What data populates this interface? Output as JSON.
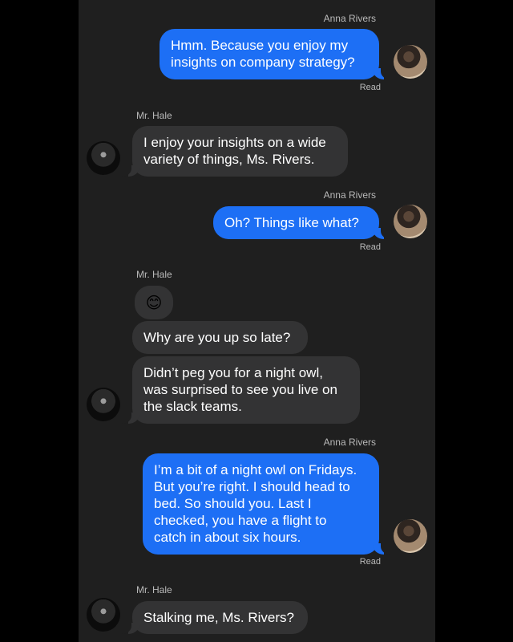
{
  "contacts": {
    "anna": {
      "name": "Anna Rivers",
      "avatar_icon": "anna-rivers-avatar"
    },
    "hale": {
      "name": "Mr. Hale",
      "avatar_icon": "mr-hale-avatar"
    }
  },
  "colors": {
    "background": "#1f1f1f",
    "outgoing_bubble": "#1d6ff5",
    "incoming_bubble": "#333334",
    "label_text": "#b9b9b9"
  },
  "messages": [
    {
      "sender": "Anna Rivers",
      "direction": "outgoing",
      "text": "Hmm. Because you enjoy my\ninsights on company strategy?",
      "status": "Read"
    },
    {
      "sender": "Mr. Hale",
      "direction": "incoming",
      "text": "I enjoy your insights on a wide\nvariety of things, Ms. Rivers."
    },
    {
      "sender": "Anna Rivers",
      "direction": "outgoing",
      "text": "Oh? Things like what?",
      "status": "Read"
    },
    {
      "sender": "Mr. Hale",
      "direction": "incoming",
      "text": "😊"
    },
    {
      "sender": "Mr. Hale",
      "direction": "incoming",
      "text": "Why are you up so late?"
    },
    {
      "sender": "Mr. Hale",
      "direction": "incoming",
      "text": "Didn’t peg you for a night owl,\nwas surprised to see you live on\nthe slack teams."
    },
    {
      "sender": "Anna Rivers",
      "direction": "outgoing",
      "text": "I’m a bit of a night owl on Fridays.\nBut you’re right. I should head to\nbed. So should you. Last I\nchecked, you have a flight to\ncatch in about six hours.",
      "status": "Read"
    },
    {
      "sender": "Mr. Hale",
      "direction": "incoming",
      "text": "Stalking me, Ms. Rivers?"
    }
  ]
}
